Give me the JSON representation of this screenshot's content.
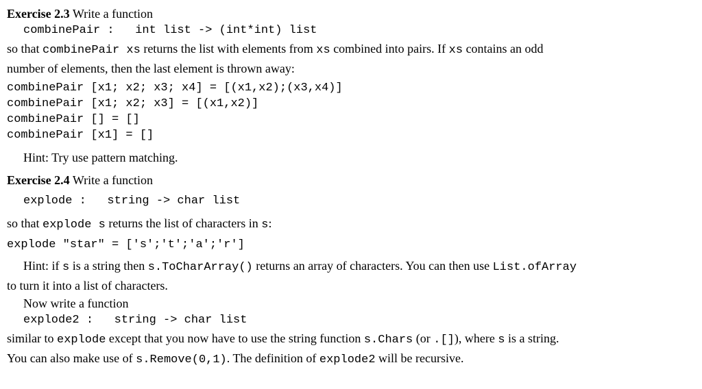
{
  "ex23": {
    "heading_label": "Exercise 2.3",
    "heading_rest": "  Write a function",
    "sig": "combinePair :   int list -> (int*int) list",
    "intro_1a": "so that ",
    "intro_1b": "combinePair xs",
    "intro_1c": " returns the list with elements from ",
    "intro_1d": "xs",
    "intro_1e": " combined into pairs.  If ",
    "intro_1f": "xs",
    "intro_1g": " contains an odd",
    "intro_2": "number of elements, then the last element is thrown away:",
    "examples": "combinePair [x1; x2; x3; x4] = [(x1,x2);(x3,x4)]\ncombinePair [x1; x2; x3] = [(x1,x2)]\ncombinePair [] = []\ncombinePair [x1] = []",
    "hint": "Hint: Try use pattern matching."
  },
  "ex24": {
    "heading_label": "Exercise 2.4",
    "heading_rest": "  Write a function",
    "sig1": "explode :   string -> char list",
    "intro_1a": "so that ",
    "intro_1b": "explode s",
    "intro_1c": " returns the list of characters in ",
    "intro_1d": "s",
    "intro_1e": ":",
    "example": "explode \"star\" = ['s';'t';'a';'r']",
    "hint1_a": "Hint: if ",
    "hint1_b": "s",
    "hint1_c": " is a string then ",
    "hint1_d": "s.ToCharArray()",
    "hint1_e": " returns an array of characters.  You can then use ",
    "hint1_f": "List.ofArray",
    "hint2": "to turn it into a list of characters.",
    "now": "Now write a function",
    "sig2": "explode2 :   string -> char list",
    "tail1_a": "similar to ",
    "tail1_b": "explode",
    "tail1_c": " except that you now have to use the string function ",
    "tail1_d": "s.Chars",
    "tail1_e": " (or ",
    "tail1_f": ".[]",
    "tail1_g": "), where ",
    "tail1_h": "s",
    "tail1_i": " is a string.",
    "tail2_a": "You can also make use of ",
    "tail2_b": "s.Remove(0,1)",
    "tail2_c": ". The definition of ",
    "tail2_d": "explode2",
    "tail2_e": " will be recursive."
  }
}
